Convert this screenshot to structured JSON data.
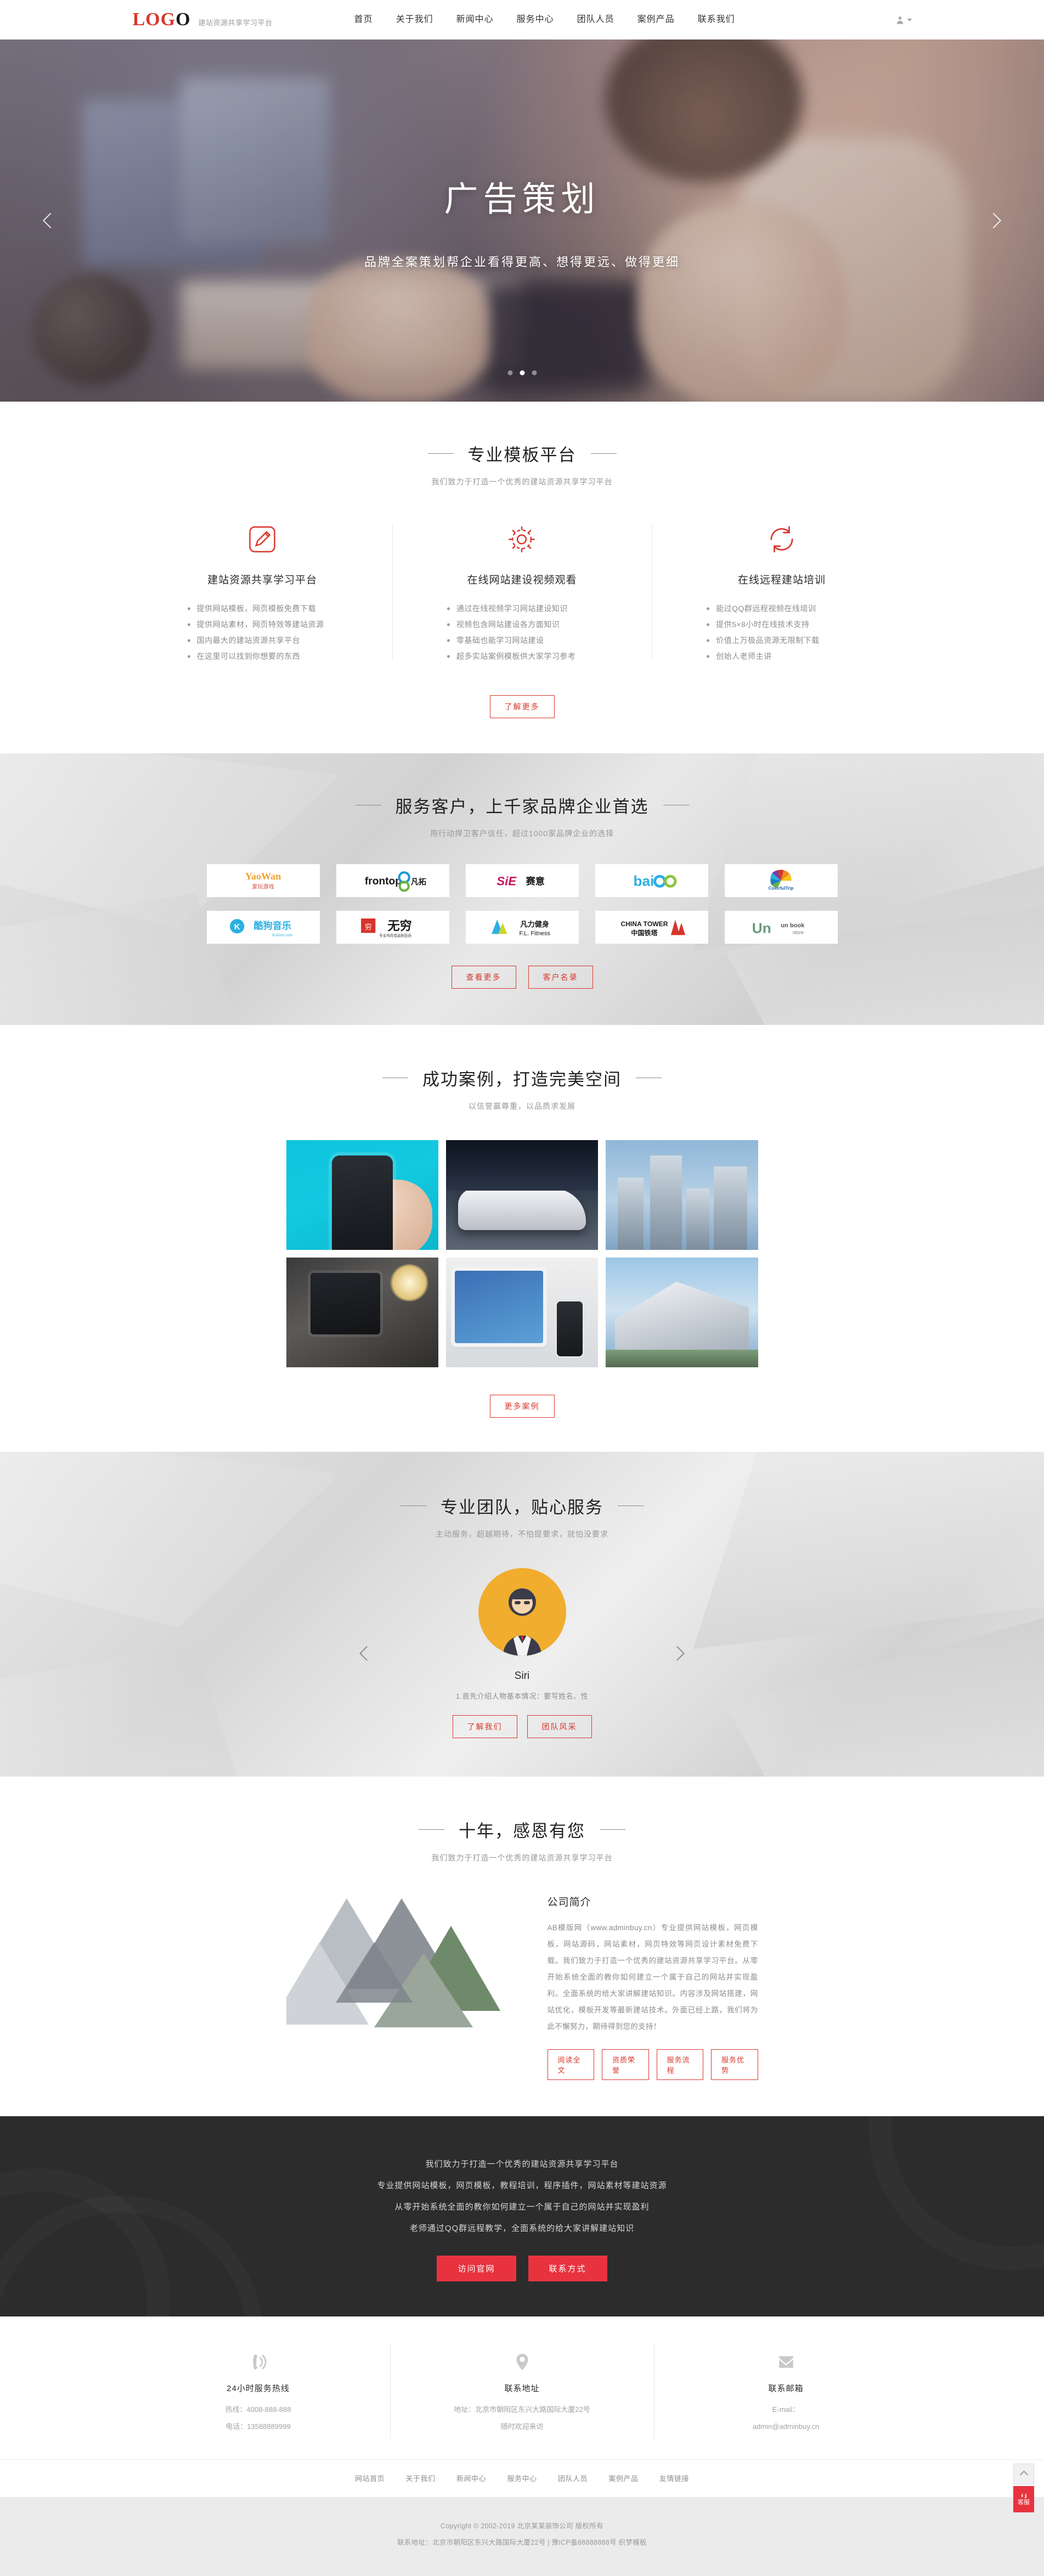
{
  "header": {
    "logo_main": "LOG",
    "logo_tail": "O",
    "logo_sub": "建站资源共享学习平台",
    "nav": [
      {
        "label": "首页"
      },
      {
        "label": "关于我们"
      },
      {
        "label": "新闻中心"
      },
      {
        "label": "服务中心"
      },
      {
        "label": "团队人员"
      },
      {
        "label": "案例产品"
      },
      {
        "label": "联系我们"
      }
    ],
    "user_icon": "user-icon"
  },
  "hero": {
    "title": "广告策划",
    "subtitle": "品牌全案策划帮企业看得更高、想得更远、做得更细",
    "prev_icon": "chevron-left-icon",
    "next_icon": "chevron-right-icon",
    "slides": 3,
    "active_slide": 2
  },
  "features": {
    "title": "专业模板平台",
    "subtitle": "我们致力于打造一个优秀的建站资源共享学习平台",
    "columns": [
      {
        "icon": "pencil-edit-icon",
        "title": "建站资源共享学习平台",
        "items": [
          "提供网站模板，网页模板免费下载",
          "提供网站素材，网页特效等建站资源",
          "国内最大的建站资源共享平台",
          "在这里可以找到你想要的东西"
        ]
      },
      {
        "icon": "gear-icon",
        "title": "在线网站建设视频观看",
        "items": [
          "通过在线视频学习网站建设知识",
          "视频包含网站建设各方面知识",
          "零基础也能学习网站建设",
          "超多实站案例模板供大家学习参考"
        ]
      },
      {
        "icon": "refresh-cycle-icon",
        "title": "在线远程建站培训",
        "items": [
          "能过QQ群远程视频在线培训",
          "提供5×8小时在线技术支持",
          "价值上万极品资源无限制下载",
          "创始人老师主讲"
        ]
      }
    ],
    "more_button": "了解更多"
  },
  "clients": {
    "title": "服务客户，上千家品牌企业首选",
    "subtitle": "用行动捍卫客户信任，超过1000家品牌企业的选择",
    "logos": [
      {
        "name": "Yaowan 爱玩游戏",
        "alt": "yaowan-logo"
      },
      {
        "name": "frontop 凡拓",
        "alt": "frontop-logo"
      },
      {
        "name": "SiE 赛意",
        "alt": "sie-logo"
      },
      {
        "name": "baioo",
        "alt": "baioo-logo"
      },
      {
        "name": "ColorfulTrip 缤纷旅游",
        "alt": "colorfultrip-logo"
      },
      {
        "name": "酷狗音乐 KuGou.com",
        "alt": "kugou-logo"
      },
      {
        "name": "无穷 专业鸡肉食品制造商",
        "alt": "wuqiong-logo"
      },
      {
        "name": "凡力健身 F.L. Fitness",
        "alt": "flfitness-logo"
      },
      {
        "name": "CHINA TOWER 中国铁塔",
        "alt": "chinatower-logo"
      },
      {
        "name": "UN book store 铀盟书店",
        "alt": "unbookstore-logo"
      }
    ],
    "btn_more": "查看更多",
    "btn_list": "客户名录"
  },
  "cases": {
    "title": "成功案例，打造完美空间",
    "subtitle": "以信誉赢尊重，以品质求发展",
    "items": [
      {
        "alt": "case-mobile-app"
      },
      {
        "alt": "case-white-sportscar"
      },
      {
        "alt": "case-skyscrapers"
      },
      {
        "alt": "case-desk-workspace"
      },
      {
        "alt": "case-tablet-devices"
      },
      {
        "alt": "case-modern-architecture"
      }
    ],
    "more_button": "更多案例"
  },
  "team": {
    "title": "专业团队，贴心服务",
    "subtitle": "主动服务，超越期待，不怕提要求，就怕没要求",
    "prev_icon": "chevron-left-icon",
    "next_icon": "chevron-right-icon",
    "member": {
      "avatar_alt": "team-member-avatar",
      "name": "Siri",
      "desc": "1.首先介绍人物基本情况：要写姓名、性"
    },
    "btn_about": "了解我们",
    "btn_style": "团队风采"
  },
  "about": {
    "title": "十年，感恩有您",
    "subtitle": "我们致力于打造一个优秀的建站资源共享学习平台",
    "art_alt": "triangle-collage-image",
    "heading": "公司简介",
    "paragraph": "AB模版网（www.adminbuy.cn）专业提供网站模板，网页模板，网站源码，网站素材，网页特效等网页设计素材免费下载。我们致力于打造一个优秀的建站资源共享学习平台。从零开始系统全面的教你如何建立一个属于自己的网站并实现盈利。全面系统的给大家讲解建站知识。内容涉及网站搭建，网站优化，模板开发等最新建站技术。外面已经上路，我们将为此不懈努力，期待得到您的支持！",
    "buttons": [
      "阅读全文",
      "资质荣誉",
      "服务流程",
      "服务优势"
    ]
  },
  "cta": {
    "lines": [
      "我们致力于打造一个优秀的建站资源共享学习平台",
      "专业提供网站模板，网页模板，教程培训，程序插件，网站素材等建站资源",
      "从零开始系统全面的教你如何建立一个属于自己的网站并实现盈利",
      "老师通过QQ群远程教学，全面系统的给大家讲解建站知识"
    ],
    "btn_site": "访问官网",
    "btn_contact": "联系方式"
  },
  "footer_contact": {
    "columns": [
      {
        "icon": "phone-ring-icon",
        "title": "24小时服务热线",
        "lines": [
          "热线：4008-888-888",
          "电话：13588889999"
        ]
      },
      {
        "icon": "map-pin-icon",
        "title": "联系地址",
        "lines": [
          "地址：北京市朝阳区东兴大路国际大厦22号",
          "随时欢迎来访"
        ]
      },
      {
        "icon": "envelope-icon",
        "title": "联系邮箱",
        "lines": [
          "E-mail：",
          "admin@adminbuy.cn"
        ]
      }
    ]
  },
  "footer_nav": [
    {
      "label": "网站首页"
    },
    {
      "label": "关于我们"
    },
    {
      "label": "新闻中心"
    },
    {
      "label": "服务中心"
    },
    {
      "label": "团队人员"
    },
    {
      "label": "案例产品"
    },
    {
      "label": "友情链接"
    }
  ],
  "copyright": {
    "line1": "Copyright © 2002-2019 北京某某装饰公司 版权所有",
    "line2": "联系地址：北京市朝阳区东兴大路国际大厦22号 | 豫ICP备88888888号 织梦模板"
  },
  "float_side": {
    "back_to_top": "back-to-top-icon",
    "service_label": "客服"
  },
  "colors": {
    "brand_red": "#d9372c",
    "cta_red": "#e8333f",
    "dark": "#2c2c2c"
  }
}
